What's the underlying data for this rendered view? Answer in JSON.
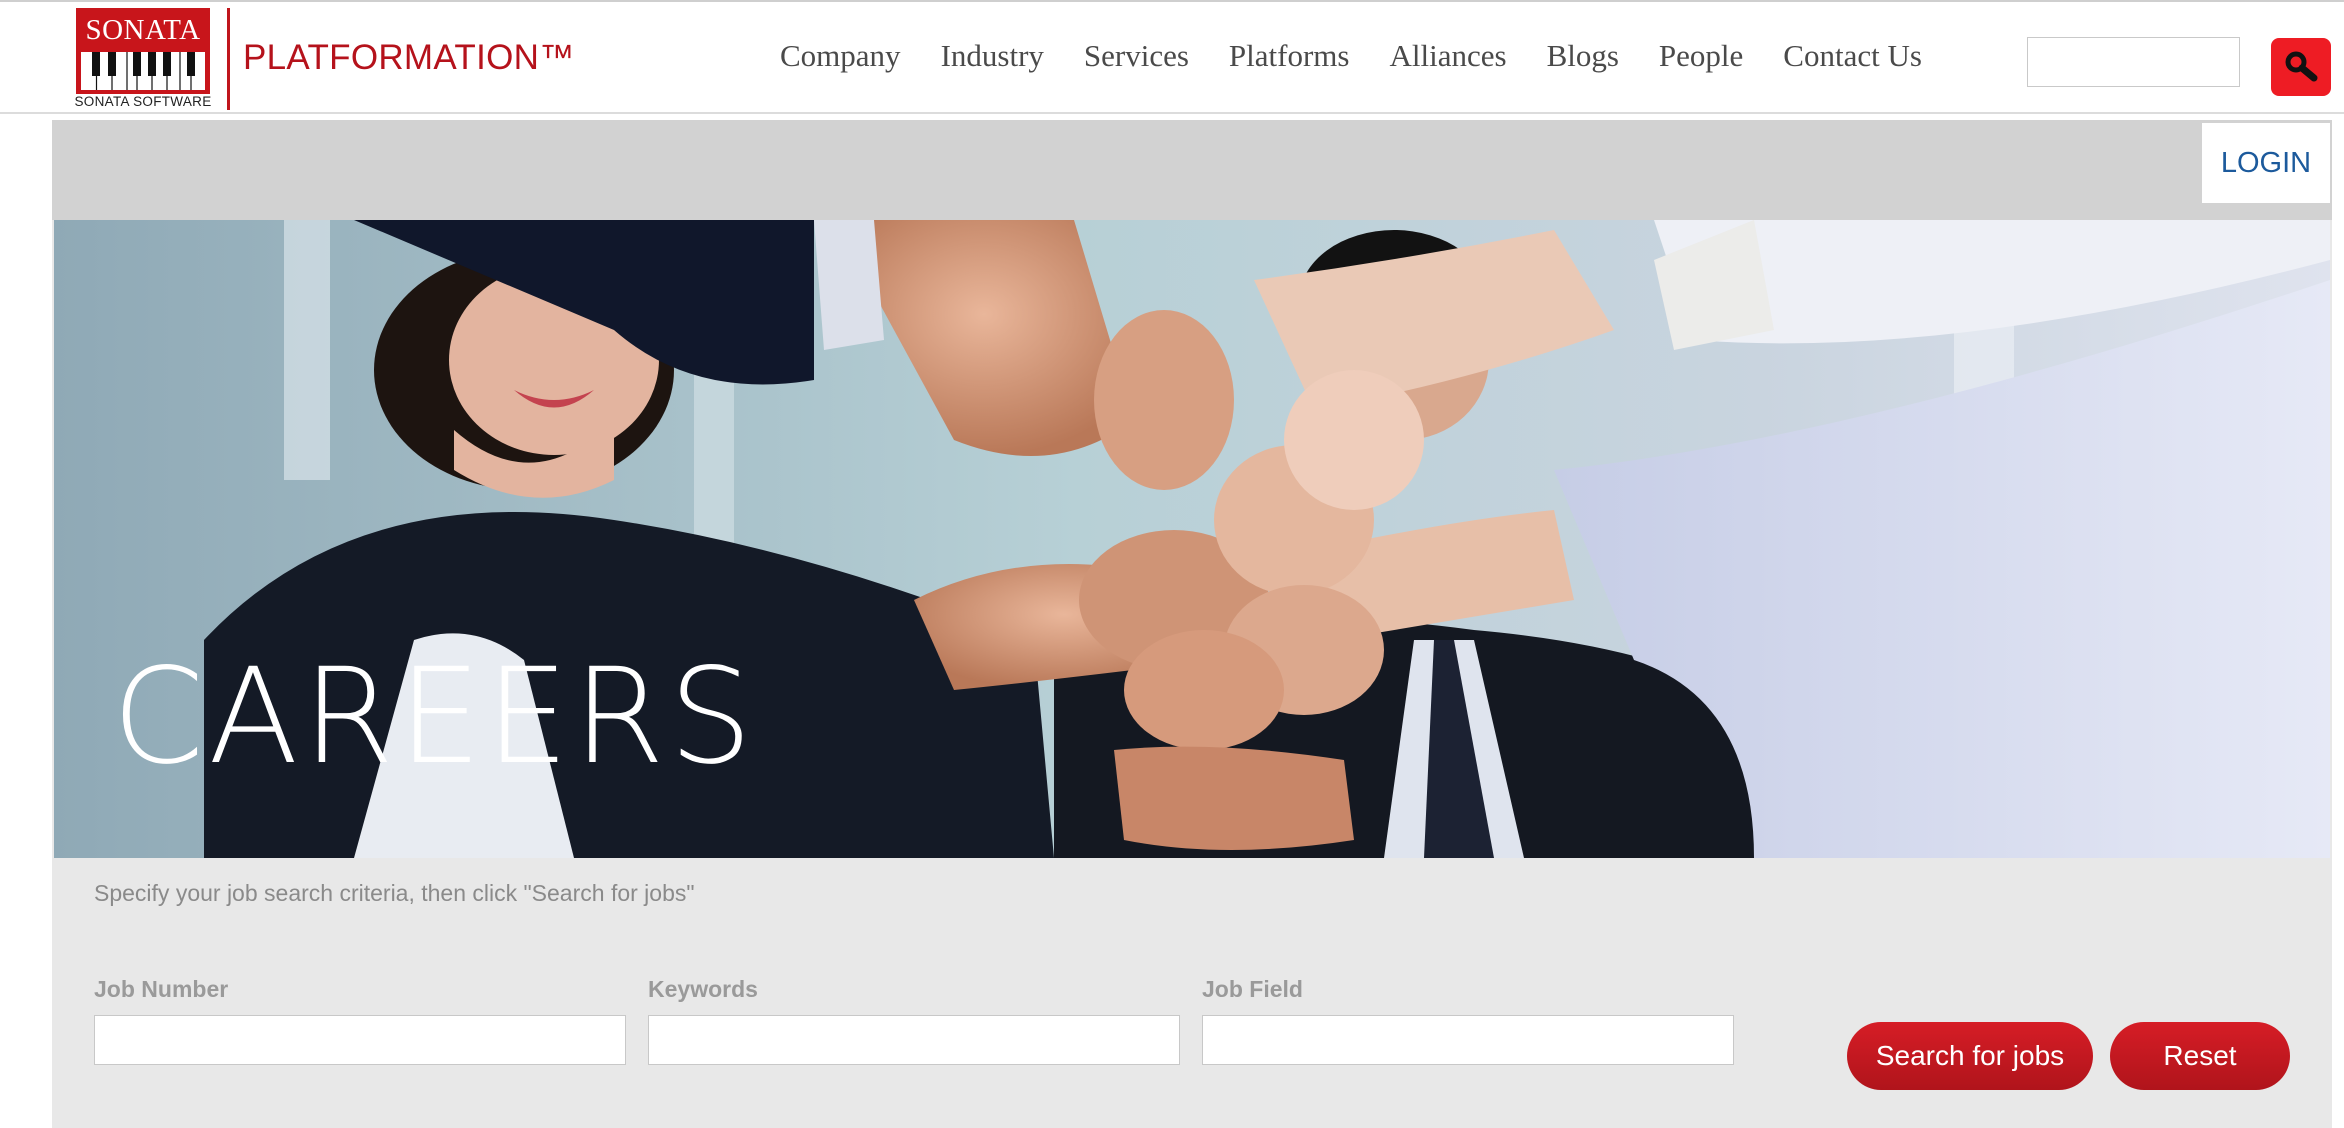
{
  "logo": {
    "word": "SONATA",
    "subtitle": "SONATA SOFTWARE",
    "icon": "piano-keys-icon"
  },
  "brand": "PLATFORMATION™",
  "nav": {
    "items": [
      {
        "label": "Company"
      },
      {
        "label": "Industry"
      },
      {
        "label": "Services"
      },
      {
        "label": "Platforms"
      },
      {
        "label": "Alliances"
      },
      {
        "label": "Blogs"
      },
      {
        "label": "People"
      },
      {
        "label": "Contact Us"
      }
    ]
  },
  "search": {
    "value": "",
    "placeholder": "",
    "button_icon": "magnifier-icon"
  },
  "login_label": "LOGIN",
  "hero": {
    "title": "CAREERS",
    "image": "team-fist-bump-photo"
  },
  "form": {
    "instructions": "Specify your job search criteria, then click \"Search for jobs\"",
    "fields": [
      {
        "label": "Job Number",
        "value": ""
      },
      {
        "label": "Keywords",
        "value": ""
      },
      {
        "label": "Job Field",
        "value": ""
      }
    ],
    "search_label": "Search for jobs",
    "reset_label": "Reset"
  },
  "colors": {
    "brand_red": "#c8151b",
    "button_red": "#d61d26",
    "search_red": "#ee1c24",
    "login_blue": "#1c5a9c"
  }
}
